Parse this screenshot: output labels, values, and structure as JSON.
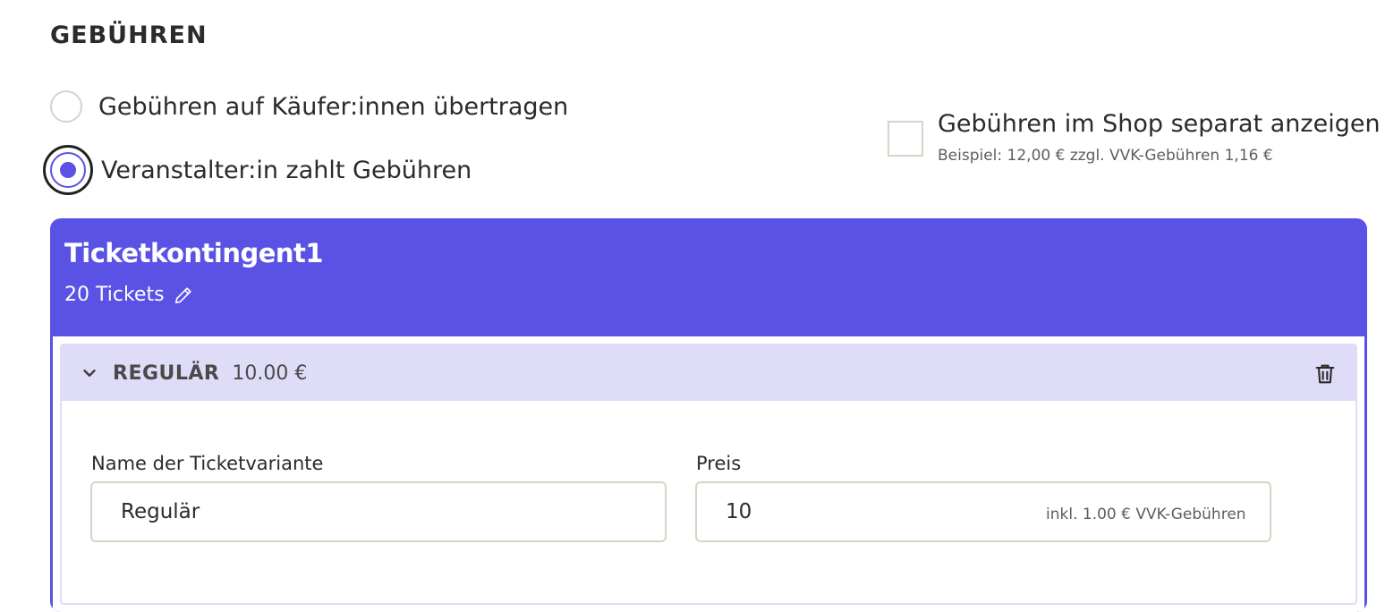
{
  "section": {
    "title": "GEBÜHREN"
  },
  "fee_options": [
    {
      "label": "Gebühren auf Käufer:innen übertragen",
      "selected": false
    },
    {
      "label": "Veranstalter:in zahlt Gebühren",
      "selected": true
    }
  ],
  "shop_display": {
    "label": "Gebühren im Shop separat anzeigen",
    "hint": "Beispiel: 12,00 € zzgl. VVK-Gebühren 1,16 €",
    "checked": false
  },
  "contingent": {
    "title": "Ticketkontingent1",
    "count": "20 Tickets",
    "color": "#5a52e4"
  },
  "variant": {
    "name": "REGULÄR",
    "price": "10.00 €",
    "name_label": "Name der Ticketvariante",
    "name_value": "Regulär",
    "price_label": "Preis",
    "price_value": "10",
    "fee_hint": "inkl. 1.00 € VVK-Gebühren"
  }
}
